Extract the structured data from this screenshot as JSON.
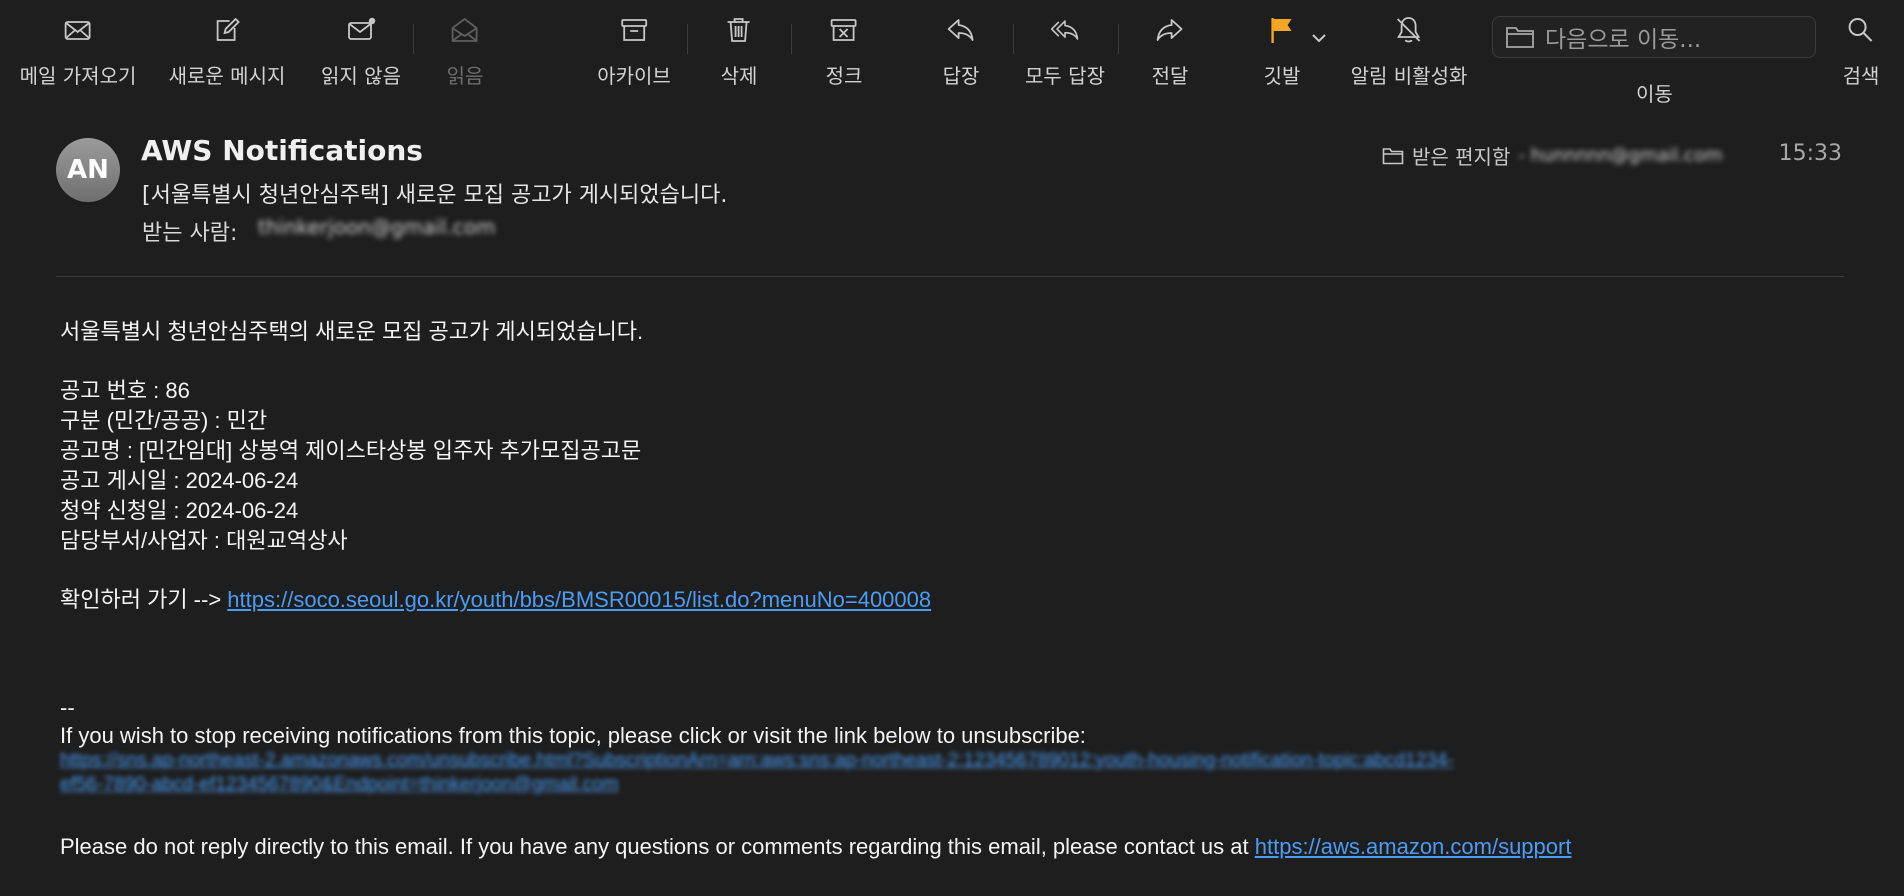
{
  "toolbar": {
    "get_mail": "메일 가져오기",
    "new_message": "새로운 메시지",
    "unread": "읽지 않음",
    "read": "읽음",
    "archive": "아카이브",
    "delete": "삭제",
    "junk": "정크",
    "reply": "답장",
    "reply_all": "모두 답장",
    "forward": "전달",
    "flag": "깃발",
    "mute": "알림 비활성화",
    "move": "이동",
    "move_placeholder": "다음으로 이동...",
    "search": "검색",
    "flag_color": "#f5a623"
  },
  "message": {
    "avatar_initials": "AN",
    "sender": "AWS Notifications",
    "subject": "[서울특별시 청년안심주택] 새로운 모집 공고가 게시되었습니다.",
    "to_label": "받는 사람:",
    "to_address": "thinkerjoon@gmail.com",
    "mailbox": "받은 편지함",
    "mailbox_account": "- hunnnnn@gmail.com",
    "time": "15:33"
  },
  "body": {
    "intro": "서울특별시 청년안심주택의 새로운 모집 공고가 게시되었습니다.",
    "notice_number": "공고 번호 : 86",
    "category": "구분 (민간/공공) : 민간",
    "notice_title": "공고명 : [민간임대] 상봉역 제이스타상봉 입주자 추가모집공고문",
    "posted_date": "공고 게시일 : 2024-06-24",
    "apply_date": "청약 신청일 : 2024-06-24",
    "department": "담당부서/사업자 : 대원교역상사",
    "check_prefix": "확인하러 가기 -->",
    "check_link": "https://soco.seoul.go.kr/youth/bbs/BMSR00015/list.do?menuNo=400008",
    "separator": "--",
    "unsubscribe_text": "If you wish to stop receiving notifications from this topic, please click or visit the link below to unsubscribe:",
    "unsubscribe_link_1": "https://sns.ap-northeast-2.amazonaws.com/unsubscribe.html?SubscriptionArn=arn:aws:sns:ap-northeast-2:123456789012:youth-housing-notification-topic:abcd1234-",
    "unsubscribe_link_2": "ef56-7890-abcd-ef1234567890&Endpoint=thinkerjoon@gmail.com",
    "footer_text": "Please do not reply directly to this email. If you have any questions or comments regarding this email, please contact us at",
    "support_link": "https://aws.amazon.com/support",
    "link_color": "#4a9cf5"
  }
}
